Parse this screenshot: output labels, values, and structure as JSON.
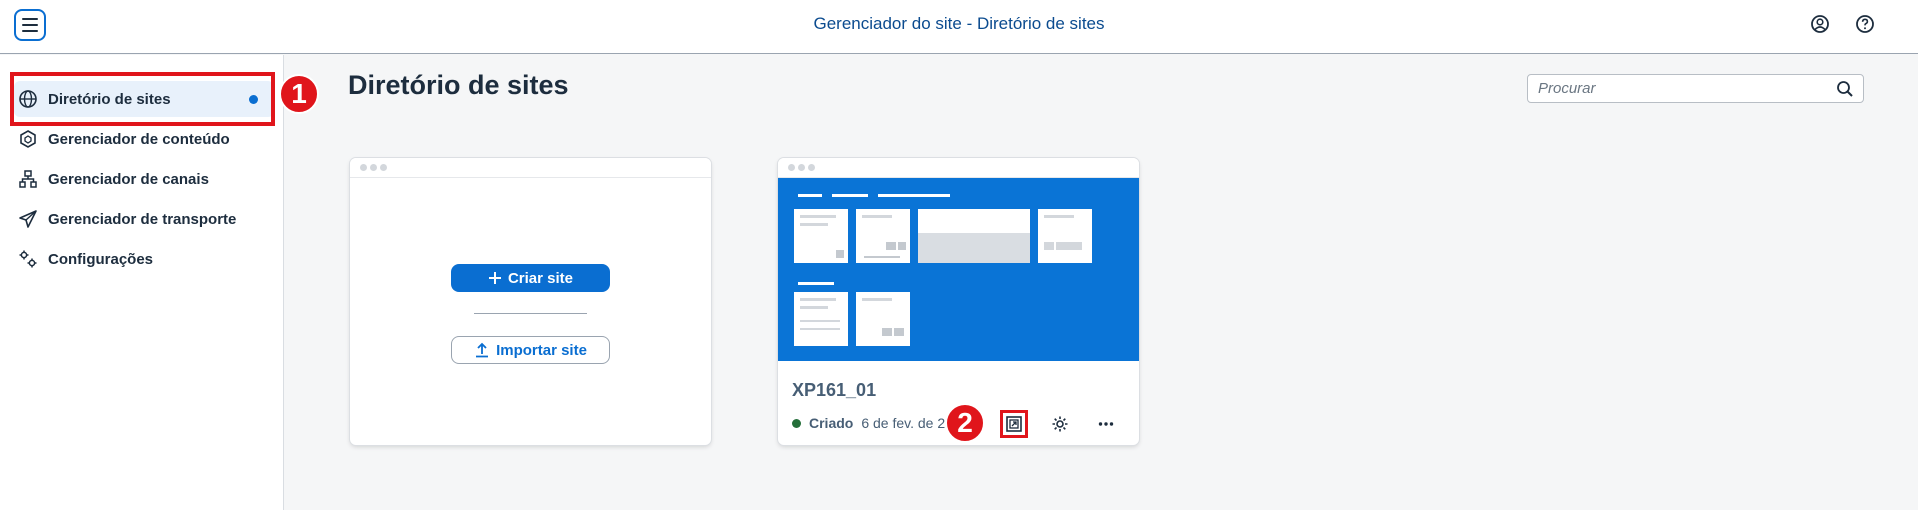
{
  "header": {
    "title": "Gerenciador do site - Diretório de sites",
    "menu_icon": "hamburger-menu-icon",
    "profile_icon": "user-profile-icon",
    "help_icon": "help-icon"
  },
  "sidebar": {
    "items": [
      {
        "label": "Diretório de sites",
        "icon": "globe-icon",
        "active": true
      },
      {
        "label": "Gerenciador de conteúdo",
        "icon": "cube-icon"
      },
      {
        "label": "Gerenciador de canais",
        "icon": "hierarchy-icon"
      },
      {
        "label": "Gerenciador de transporte",
        "icon": "paper-plane-icon"
      },
      {
        "label": "Configurações",
        "icon": "gears-icon"
      }
    ]
  },
  "main": {
    "title": "Diretório de sites",
    "search_placeholder": "Procurar",
    "create_card": {
      "create_label": "Criar site",
      "import_label": "Importar site"
    },
    "site_card": {
      "name": "XP161_01",
      "status": "Criado",
      "date": "6 de fev. de 2"
    }
  },
  "annotations": {
    "callout_1": "1",
    "callout_2": "2",
    "color": "#e0151b"
  },
  "colors": {
    "accent": "#0a6ed1",
    "status_green": "#256f3a",
    "thumbnail_blue": "#0a74d6"
  }
}
